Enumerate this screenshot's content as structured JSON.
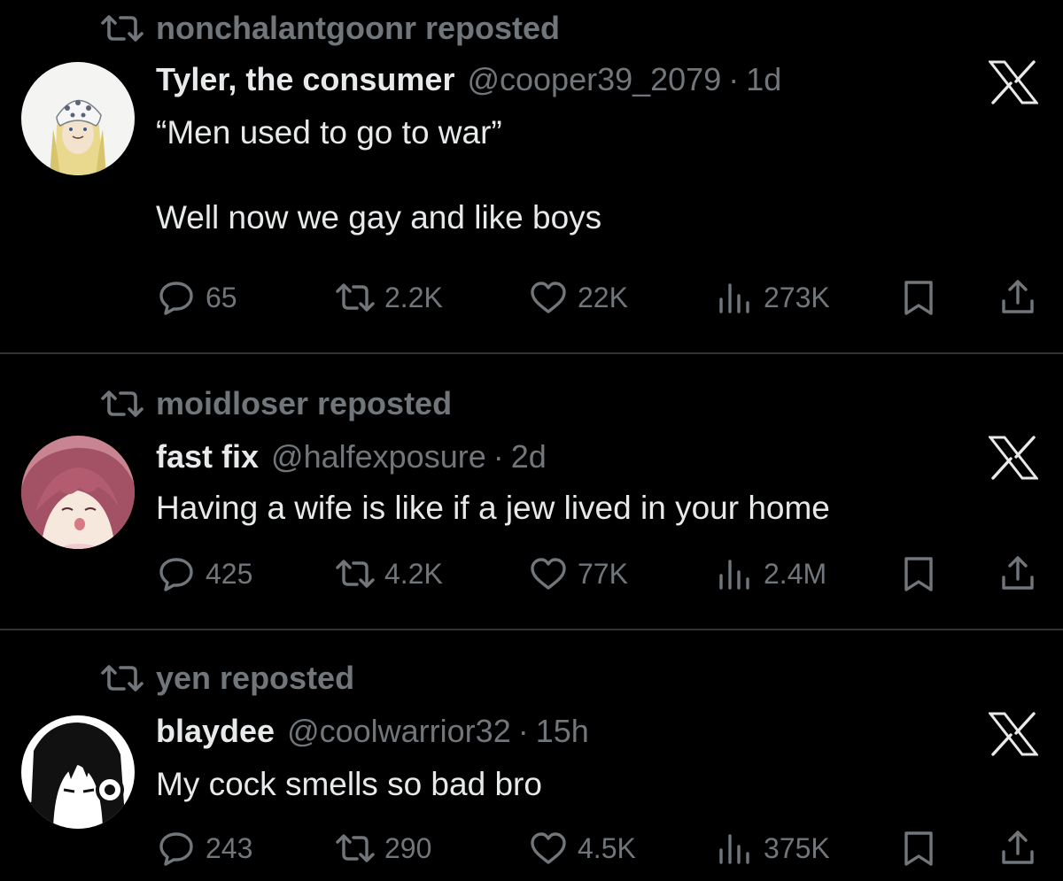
{
  "colors": {
    "background": "#000000",
    "text": "#e7e9ea",
    "secondary": "#71767b",
    "divider": "#2f3336"
  },
  "posts": [
    {
      "reposted_by": "nonchalantgoonr reposted",
      "author_name": "Tyler, the consumer",
      "handle": "@cooper39_2079",
      "separator": "·",
      "time": "1d",
      "text": "“Men used to go to war”\n\nWell now we gay and like boys",
      "replies": "65",
      "reposts": "2.2K",
      "likes": "22K",
      "views": "273K",
      "avatar_icon": "anime-avatar-blonde-bandana",
      "menu_icon": "x-logo-icon"
    },
    {
      "reposted_by": "moidloser reposted",
      "author_name": "fast fix",
      "handle": "@halfexposure",
      "separator": "·",
      "time": "2d",
      "text": "Having a wife is like if a jew lived in your home",
      "replies": "425",
      "reposts": "4.2K",
      "likes": "77K",
      "views": "2.4M",
      "avatar_icon": "anime-avatar-pink-hair",
      "menu_icon": "x-logo-icon"
    },
    {
      "reposted_by": "yen reposted",
      "author_name": "blaydee",
      "handle": "@coolwarrior32",
      "separator": "·",
      "time": "15h",
      "text": "My cock smells so bad bro",
      "replies": "243",
      "reposts": "290",
      "likes": "4.5K",
      "views": "375K",
      "avatar_icon": "manga-avatar-headphones",
      "menu_icon": "x-logo-icon"
    }
  ]
}
